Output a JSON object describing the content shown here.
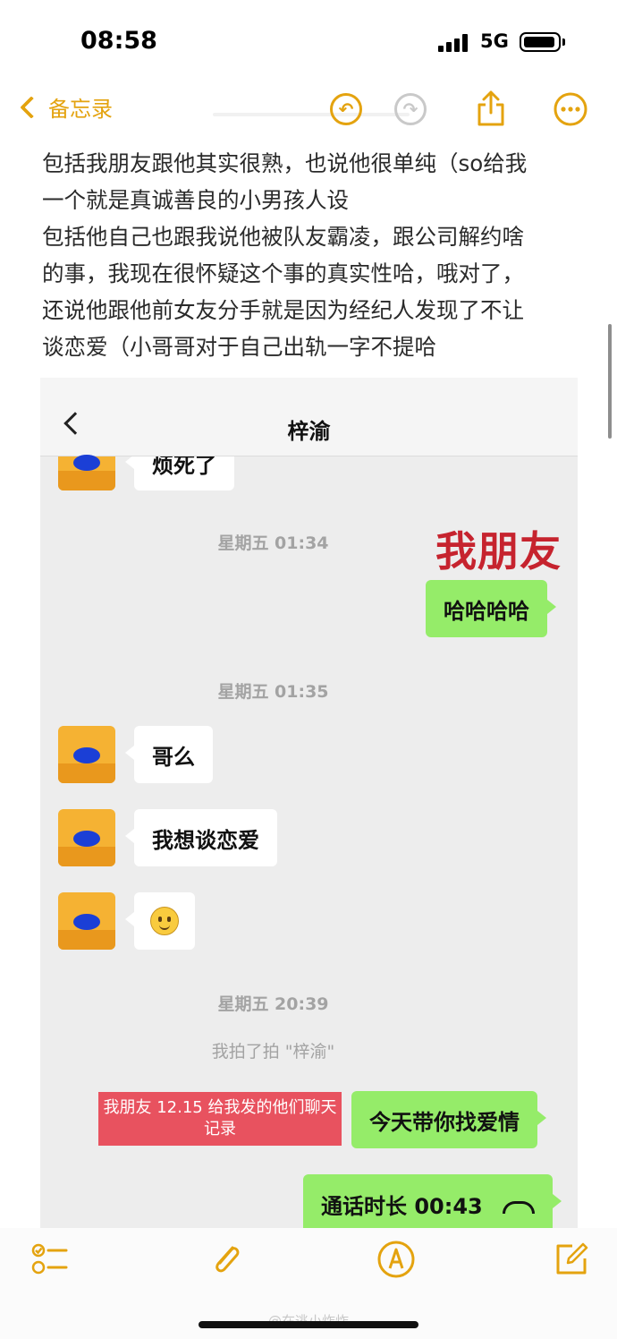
{
  "status_bar": {
    "time": "08:58",
    "network": "5G"
  },
  "nav": {
    "back_label": "备忘录",
    "undo_glyph": "↶",
    "redo_glyph": "↷"
  },
  "note": {
    "lines": [
      "包括我朋友跟他其实很熟，也说他很单纯（so给我",
      "一个就是真诚善良的小男孩人设",
      "包括他自己也跟我说他被队友霸凌，跟公司解约啥",
      "的事，我现在很怀疑这个事的真实性哈，哦对了，",
      "还说他跟他前女友分手就是因为经纪人发现了不让",
      "谈恋爱（小哥哥对于自己出轨一字不提哈"
    ]
  },
  "chat": {
    "title": "梓渝",
    "friend_overlay": "我朋友",
    "messages": {
      "m0": "烦死了",
      "t1": "星期五 01:34",
      "m1": "哈哈哈哈",
      "t2": "星期五 01:35",
      "m2": "哥么",
      "m3": "我想谈恋爱",
      "t3": "星期五 20:39",
      "sys1": "我拍了拍 \"梓渝\"",
      "m5": "今天带你找爱情",
      "m6": "通话时长 00:43"
    },
    "red_note": "我朋友 12.15 给我发的他们聊天记录"
  },
  "toolbar": {
    "weibo_mark": "@在逃小炸炸"
  },
  "colors": {
    "accent": "#e4a30f",
    "bubble_green": "#95ec69",
    "overlay_red": "#c6232e",
    "note_red": "#e8525f"
  },
  "icons": [
    "chevron-left-icon",
    "undo-icon",
    "redo-icon",
    "share-icon",
    "more-icon",
    "checklist-icon",
    "attachment-icon",
    "markup-icon",
    "compose-icon",
    "smiley-emoji-icon",
    "hangup-icon"
  ]
}
